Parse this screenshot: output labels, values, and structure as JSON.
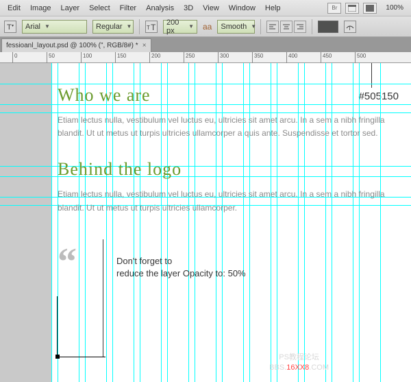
{
  "menu": {
    "items": [
      "Edit",
      "Image",
      "Layer",
      "Select",
      "Filter",
      "Analysis",
      "3D",
      "View",
      "Window",
      "Help"
    ],
    "zoom": "100%"
  },
  "options": {
    "font": "Arial",
    "weight": "Regular",
    "size": "200 px",
    "aa_label": "aa",
    "aa": "Smooth"
  },
  "tab": {
    "label": "fessioanl_layout.psd @ 100% (\", RGB/8#) *"
  },
  "ruler": {
    "ticks": [
      "0",
      "50",
      "100",
      "150",
      "200",
      "250",
      "300",
      "350",
      "400",
      "450",
      "500"
    ]
  },
  "callout": {
    "color": "#505150"
  },
  "doc": {
    "h1a": "Who we are",
    "p1": "Etiam lectus nulla, vestibulum vel luctus eu, ultricies sit amet arcu. In a sem a nibh fringilla blandit. Ut ut metus ut turpis ultricies ullamcorper a quis ante. Suspendisse et tortor sed.",
    "h1b": "Behind the logo",
    "p2": "Etiam lectus nulla, vestibulum vel luctus eu, ultricies sit amet arcu. In a sem a nibh fringilla blandit. Ut ut metus ut turpis ultricies ullamcorper."
  },
  "note": {
    "l1": "Don't forget to",
    "l2": "reduce the layer Opacity to: 50%"
  },
  "watermark": {
    "l1": "PS教程论坛",
    "l2a": "BBS.",
    "l2b": "16XX8",
    "l2c": ".COM"
  }
}
